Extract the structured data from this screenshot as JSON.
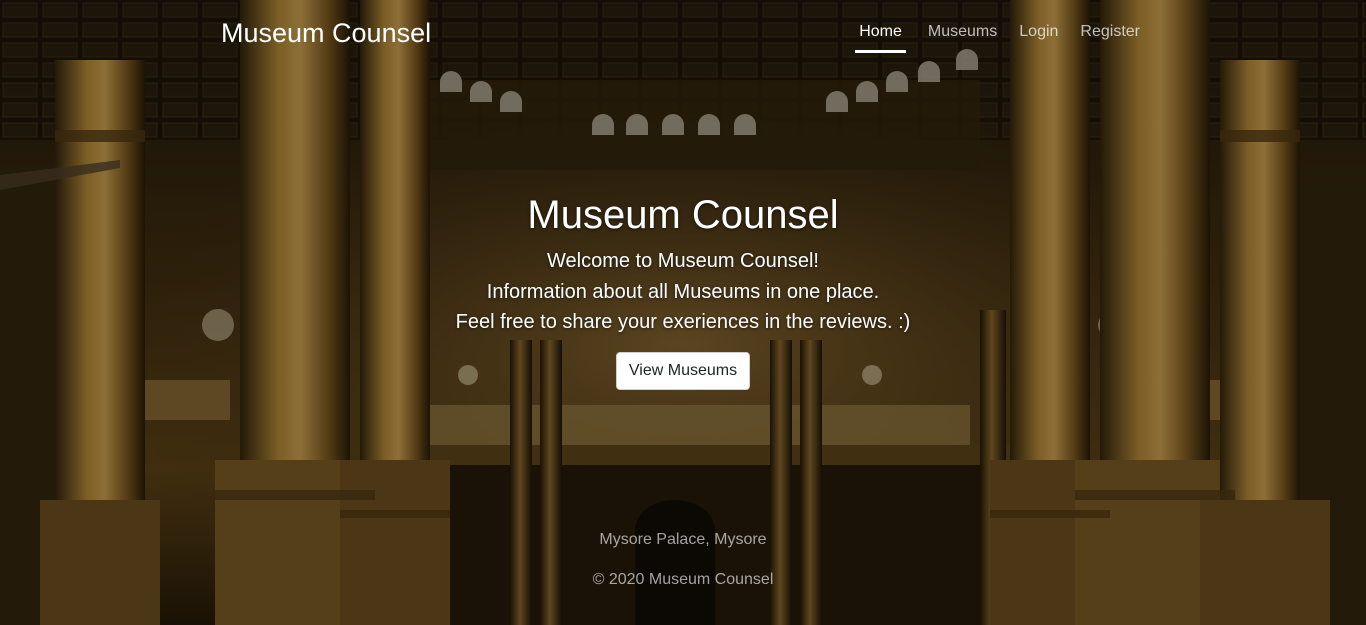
{
  "navbar": {
    "brand": "Museum Counsel",
    "links": [
      {
        "label": "Home",
        "active": true
      },
      {
        "label": "Museums",
        "active": false
      },
      {
        "label": "Login",
        "active": false
      },
      {
        "label": "Register",
        "active": false
      }
    ]
  },
  "hero": {
    "title": "Museum Counsel",
    "lines": [
      "Welcome to Museum Counsel!",
      "Information about all Museums in one place.",
      "Feel free to share your exeriences in the reviews. :)"
    ],
    "button_label": "View Museums"
  },
  "footer": {
    "image_caption": "Mysore Palace, Mysore",
    "copyright": "© 2020 Museum Counsel"
  },
  "colors": {
    "text": "#ffffff",
    "nav_inactive": "rgba(255,255,255,0.72)",
    "footer_text": "rgba(255,255,255,0.62)",
    "button_bg": "#ffffff",
    "button_text": "#212529",
    "gold": "#b8862e",
    "dark": "#1a1206"
  }
}
